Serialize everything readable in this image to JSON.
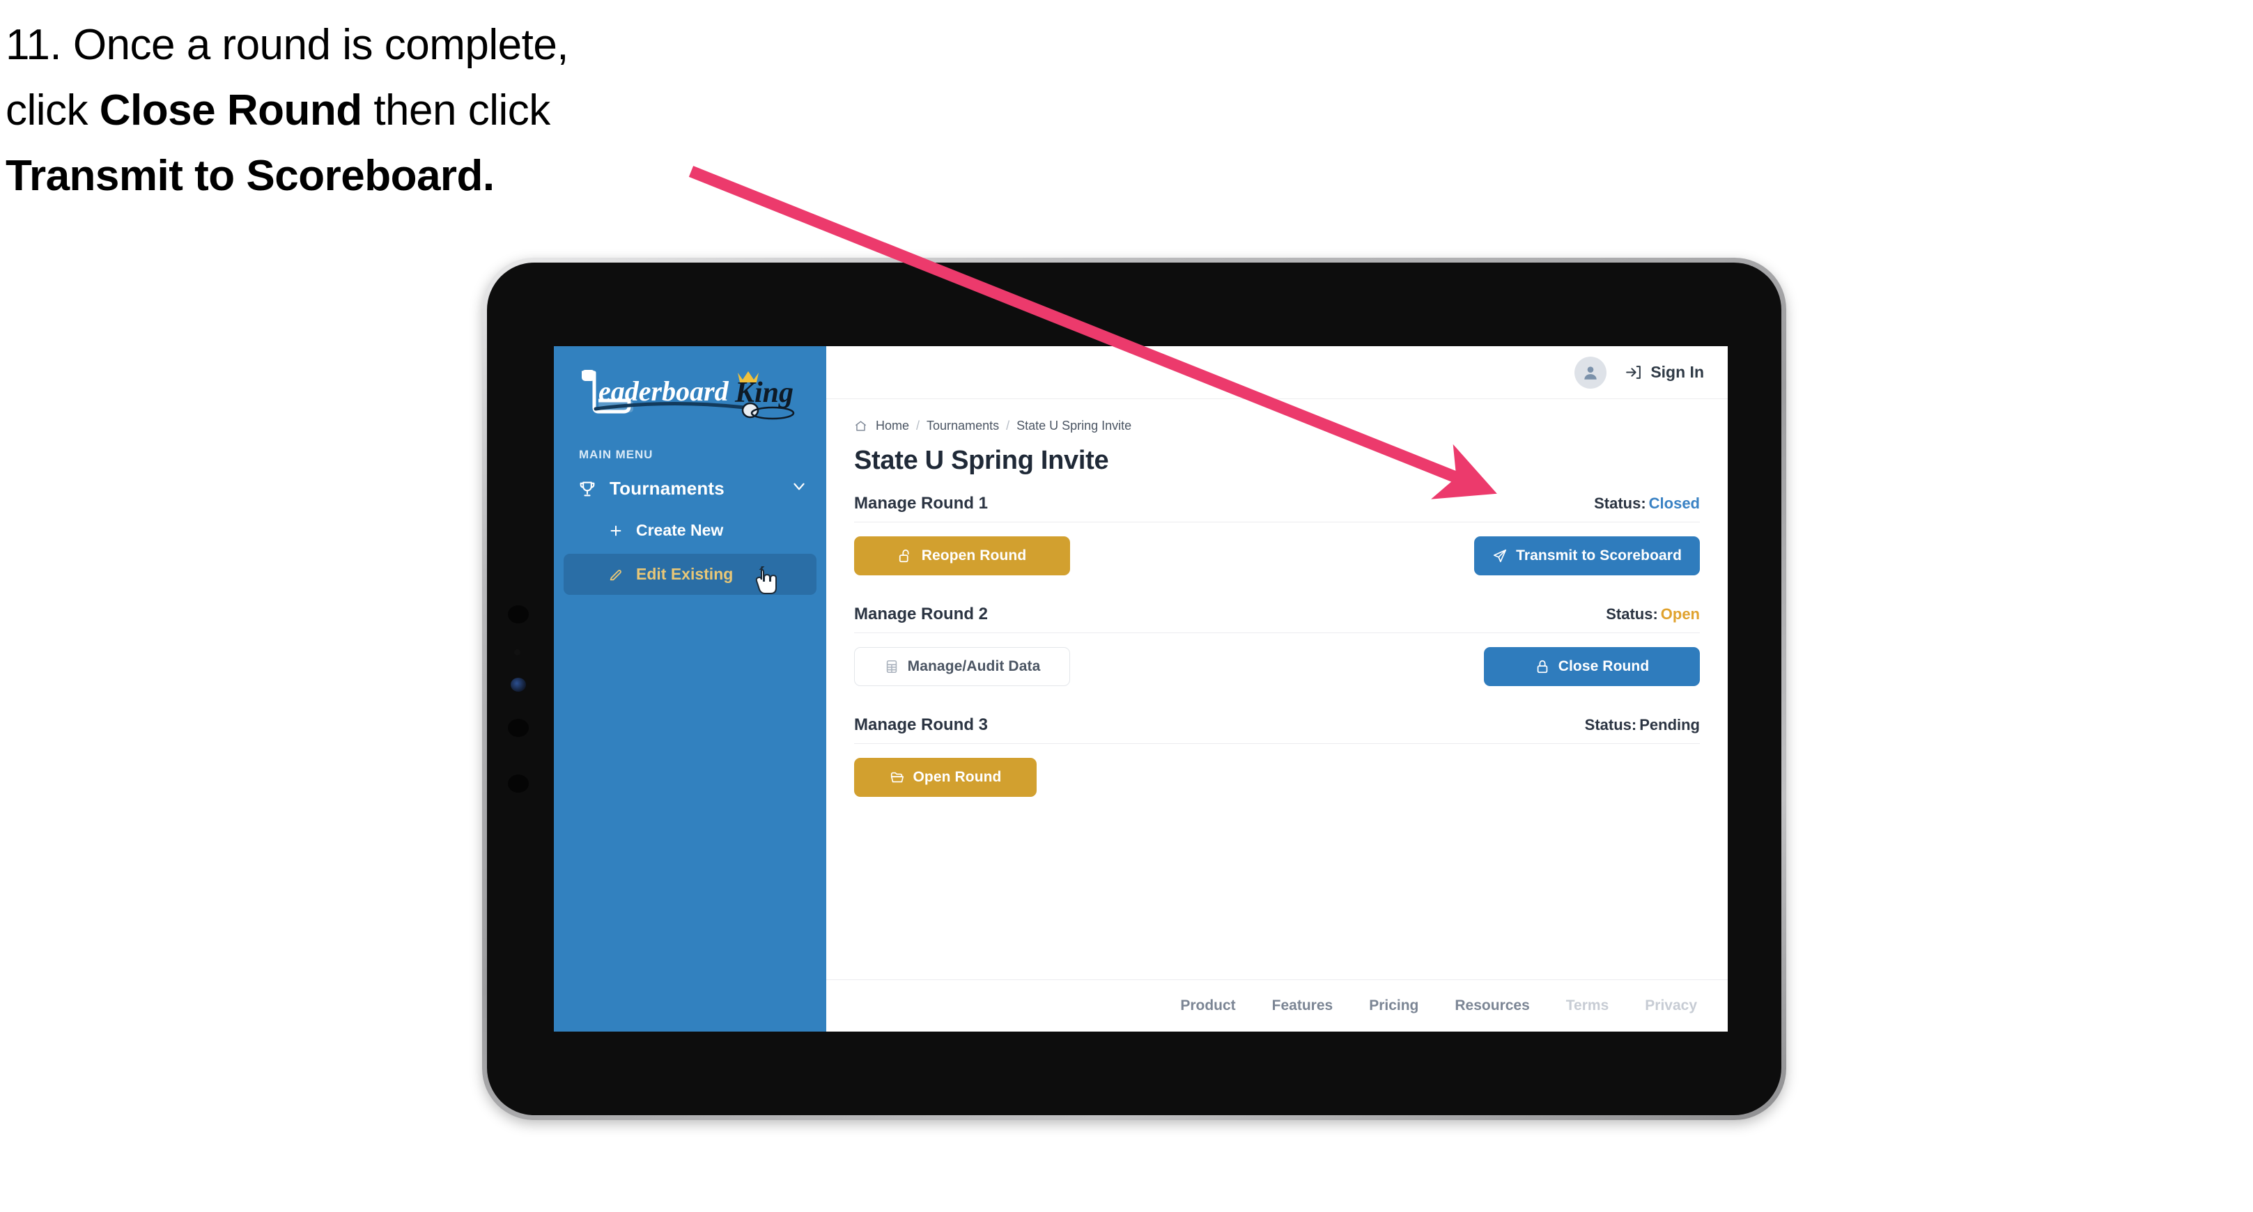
{
  "caption": {
    "line1_prefix": "11. Once a round is complete,",
    "line2_prefix": "click ",
    "line2_bold": "Close Round",
    "line2_suffix": " then click",
    "line3_bold": "Transmit to Scoreboard."
  },
  "annotation": {
    "arrow_color": "#ec3a6c",
    "points_to": "Transmit to Scoreboard"
  },
  "sidebar": {
    "logo_text": "LeaderboardKing",
    "logo_word1": "Leaderboard",
    "logo_word2": "King",
    "section_label": "MAIN MENU",
    "background_color": "#3281bf",
    "active_color": "#2a6ea6",
    "active_text_color": "#e8c777",
    "nav": [
      {
        "label": "Tournaments",
        "icon": "trophy-icon",
        "expanded": true,
        "chevron": "chevron-down-icon"
      }
    ],
    "sub_nav": [
      {
        "label": "Create New",
        "icon": "plus-icon",
        "active": false
      },
      {
        "label": "Edit Existing",
        "icon": "edit-pencil-icon",
        "active": true
      }
    ]
  },
  "topbar": {
    "avatar_icon": "user-avatar-icon",
    "signin_icon": "sign-in-arrow-icon",
    "signin_label": "Sign In"
  },
  "breadcrumb": {
    "home_icon": "home-icon",
    "items": [
      "Home",
      "Tournaments",
      "State U Spring Invite"
    ],
    "separator": "/"
  },
  "page": {
    "title": "State U Spring Invite"
  },
  "rounds": [
    {
      "name": "Manage Round 1",
      "status_label": "Status:",
      "status_value": "Closed",
      "status_color": "#3a82c4",
      "left_button": {
        "label": "Reopen Round",
        "icon": "unlock-icon",
        "style": "gold"
      },
      "right_button": {
        "label": "Transmit to Scoreboard",
        "icon": "paper-plane-icon",
        "style": "blue"
      }
    },
    {
      "name": "Manage Round 2",
      "status_label": "Status:",
      "status_value": "Open",
      "status_color": "#e0a22e",
      "left_button": {
        "label": "Manage/Audit Data",
        "icon": "spreadsheet-icon",
        "style": "ghost"
      },
      "right_button": {
        "label": "Close Round",
        "icon": "lock-icon",
        "style": "blue"
      }
    },
    {
      "name": "Manage Round 3",
      "status_label": "Status:",
      "status_value": "Pending",
      "status_color": "#2b3442",
      "left_button": {
        "label": "Open Round",
        "icon": "folder-open-icon",
        "style": "gold"
      },
      "right_button": null
    }
  ],
  "footer": {
    "links": [
      {
        "label": "Product",
        "muted": false
      },
      {
        "label": "Features",
        "muted": false
      },
      {
        "label": "Pricing",
        "muted": false
      },
      {
        "label": "Resources",
        "muted": false
      },
      {
        "label": "Terms",
        "muted": true
      },
      {
        "label": "Privacy",
        "muted": true
      }
    ]
  },
  "colors": {
    "gold": "#d2a02f",
    "blue": "#2f7cbd",
    "sidebar_blue": "#3281bf",
    "text_dark": "#2b3442"
  }
}
